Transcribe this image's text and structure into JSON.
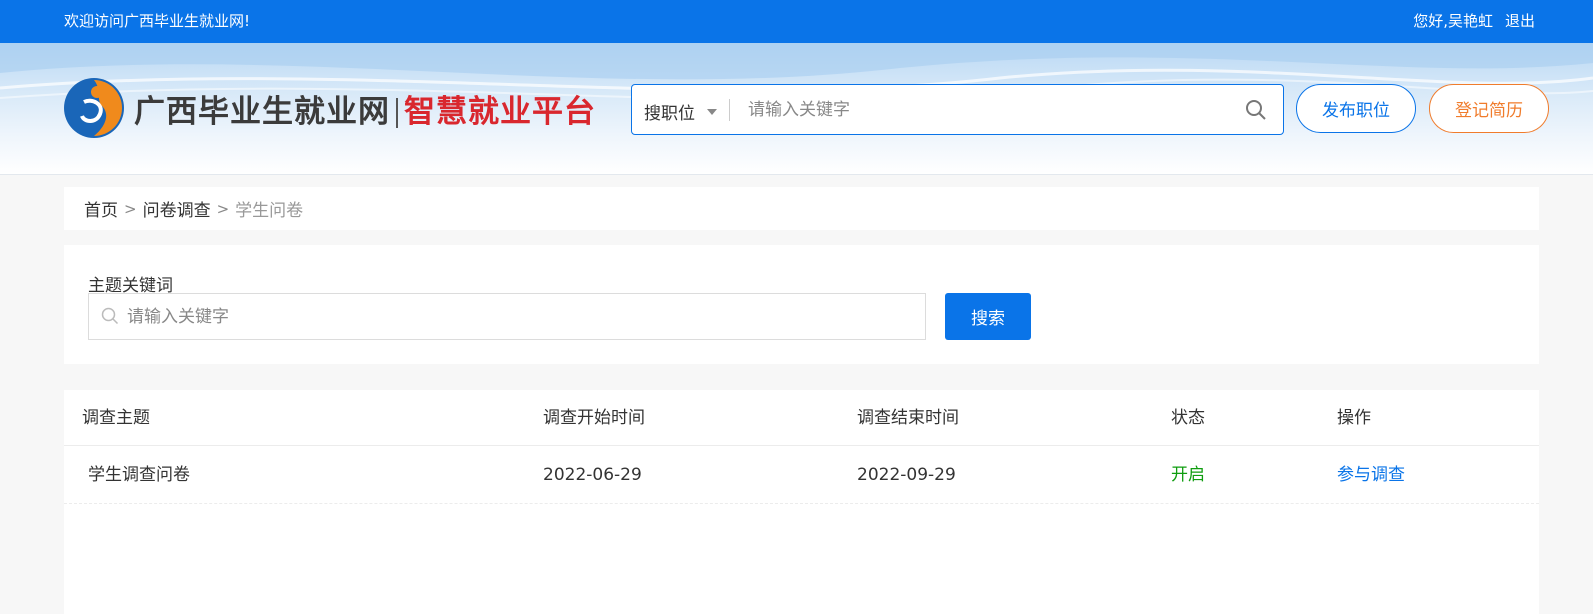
{
  "topbar": {
    "welcome": "欢迎访问广西毕业生就业网!",
    "greeting": "您好,吴艳虹",
    "logout": "退出"
  },
  "header": {
    "logo_text": "广西毕业生就业网",
    "logo_sub": "智慧就业平台",
    "search_type": "搜职位",
    "search_placeholder": "请输入关键字",
    "post_job_label": "发布职位",
    "resume_label": "登记简历"
  },
  "breadcrumb": {
    "items": [
      "首页",
      "问卷调查"
    ],
    "current": "学生问卷"
  },
  "filter": {
    "keyword_label": "主题关键词",
    "keyword_placeholder": "请输入关键字",
    "search_label": "搜索"
  },
  "table": {
    "columns": [
      "调查主题",
      "调查开始时间",
      "调查结束时间",
      "状态",
      "操作"
    ],
    "rows": [
      {
        "topic": "学生调查问卷",
        "start": "2022-06-29",
        "end": "2022-09-29",
        "status": "开启",
        "action": "参与调查"
      }
    ]
  },
  "colors": {
    "primary": "#0a74e8",
    "accent_orange": "#f07c2c",
    "status_open": "#0f9d0f",
    "logo_red": "#d9272e"
  }
}
